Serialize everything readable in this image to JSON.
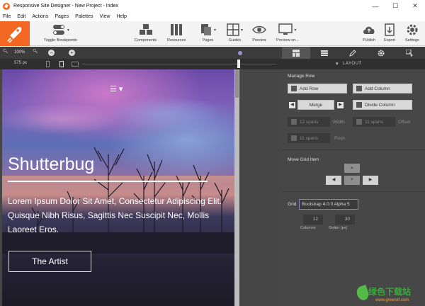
{
  "window": {
    "title": "Responsive Site Designer - New Project - Index",
    "minimize": "—",
    "maximize": "☐",
    "close": "✕"
  },
  "menu": [
    "File",
    "Edit",
    "Actions",
    "Pages",
    "Palettes",
    "View",
    "Help"
  ],
  "toolbar": {
    "toggle_breakpoints": "Toggle Breakpoints",
    "components": "Components",
    "resources": "Resources",
    "pages": "Pages",
    "guides": "Guides",
    "preview": "Preview",
    "preview_on": "Preview on...",
    "publish": "Publish",
    "export": "Export",
    "settings": "Settings"
  },
  "zoom": {
    "value": "100%",
    "zoom_out": "−",
    "zoom_in": "+",
    "width_px": "575 px"
  },
  "preview_site": {
    "headline": "Shutterbug",
    "body": "Lorem Ipsum Dolor Sit Amet, Consectetur Adipiscing Elit. Quisque Nibh Risus, Sagittis Nec Suscipit Nec, Mollis Laoreet Eros.",
    "cta": "The Artist",
    "menu_icon": "☰ ▾"
  },
  "panel": {
    "header": "LAYOUT",
    "manage_row": {
      "title": "Manage Row",
      "add_row": "Add Row",
      "add_column": "Add Column",
      "merge": "Merge",
      "divide_column": "Divide Column",
      "width_value": "12 spans",
      "width_label": "Width",
      "offset_value": "11 spans",
      "offset_label": "Offset",
      "push_value": "11 spans",
      "push_label": "Push"
    },
    "move_grid_item": {
      "title": "Move Grid Item"
    },
    "grid": {
      "label": "Grid",
      "value": "Bootstrap 4.0.0 Alpha 5",
      "columns_value": "12",
      "columns_label": "Columns",
      "gutter_value": "30",
      "gutter_label": "Gutter (px)"
    }
  },
  "watermark": {
    "title": "绿色下载站",
    "url": "www.greenxf.com"
  },
  "colors": {
    "brand_orange": "#f26722",
    "dark_panel": "#474747",
    "accent_purple": "#8a80c8"
  }
}
